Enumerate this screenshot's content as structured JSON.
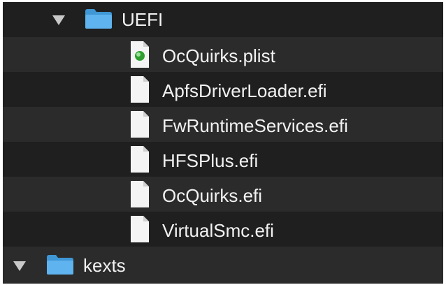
{
  "tree": {
    "folder_uefi": {
      "label": "UEFI",
      "icon": "folder-icon",
      "expanded": true
    },
    "files": [
      {
        "label": "OcQuirks.plist",
        "icon": "plist-file-icon"
      },
      {
        "label": "ApfsDriverLoader.efi",
        "icon": "document-icon"
      },
      {
        "label": "FwRuntimeServices.efi",
        "icon": "document-icon"
      },
      {
        "label": "HFSPlus.efi",
        "icon": "document-icon"
      },
      {
        "label": "OcQuirks.efi",
        "icon": "document-icon"
      },
      {
        "label": "VirtualSmc.efi",
        "icon": "document-icon"
      }
    ],
    "folder_kexts": {
      "label": "kexts",
      "icon": "folder-icon",
      "expanded": true
    }
  },
  "colors": {
    "background": "#1f1f1f",
    "row_alt": "#2b2b2b",
    "folder_blue": "#4aa3e0",
    "text": "#f2f2f2",
    "plist_green": "#3bb53b"
  }
}
